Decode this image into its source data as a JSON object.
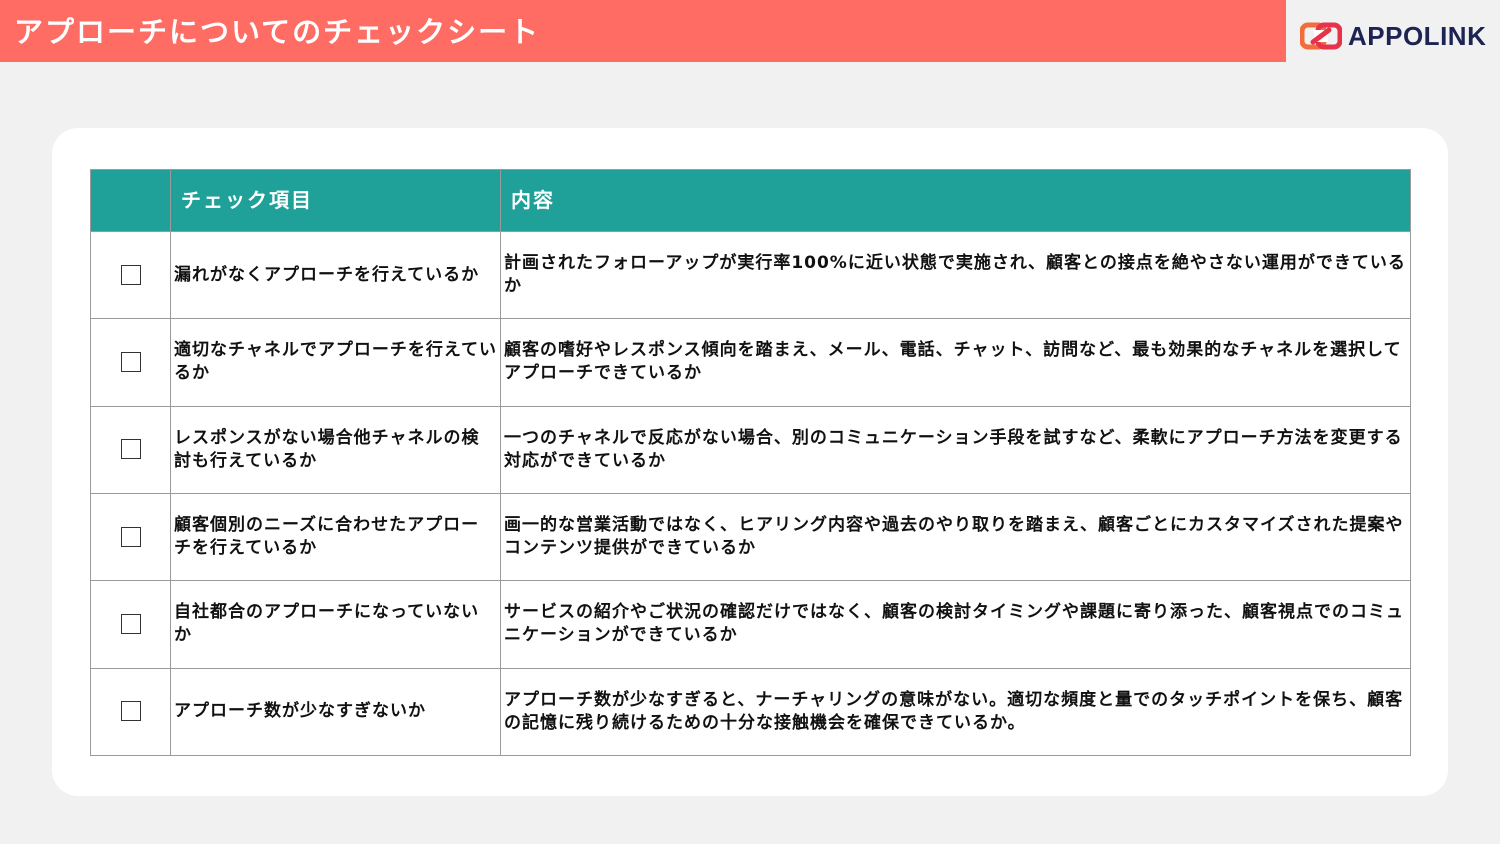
{
  "header": {
    "title": "アプローチについてのチェックシート"
  },
  "logo": {
    "text": "APPOLINK",
    "icon": "appolink-link-icon",
    "colors": {
      "orange": "#f26d3d",
      "red": "#e8324a",
      "navy": "#1d2353"
    }
  },
  "colors": {
    "header_bar": "#fe6c63",
    "table_header": "#1fa19a",
    "background": "#f1f1f1"
  },
  "table": {
    "columns": [
      "",
      "チェック項目",
      "内容"
    ],
    "rows": [
      {
        "item": "漏れがなくアプローチを行えているか",
        "content": "計画されたフォローアップが実行率100%に近い状態で実施され、顧客との接点を絶やさない運用ができているか"
      },
      {
        "item": "適切なチャネルでアプローチを行えているか",
        "content": "顧客の嗜好やレスポンス傾向を踏まえ、メール、電話、チャット、訪問など、最も効果的なチャネルを選択してアプローチできているか"
      },
      {
        "item": "レスポンスがない場合他チャネルの検討も行えているか",
        "content": "一つのチャネルで反応がない場合、別のコミュニケーション手段を試すなど、柔軟にアプローチ方法を変更する対応ができているか"
      },
      {
        "item": "顧客個別のニーズに合わせたアプローチを行えているか",
        "content": "画一的な営業活動ではなく、ヒアリング内容や過去のやり取りを踏まえ、顧客ごとにカスタマイズされた提案やコンテンツ提供ができているか"
      },
      {
        "item": "自社都合のアプローチになっていないか",
        "content": "サービスの紹介やご状況の確認だけではなく、顧客の検討タイミングや課題に寄り添った、顧客視点でのコミュニケーションができているか"
      },
      {
        "item": "アプローチ数が少なすぎないか",
        "content": "アプローチ数が少なすぎると、ナーチャリングの意味がない。適切な頻度と量でのタッチポイントを保ち、顧客の記憶に残り続けるための十分な接触機会を確保できているか。"
      }
    ]
  }
}
